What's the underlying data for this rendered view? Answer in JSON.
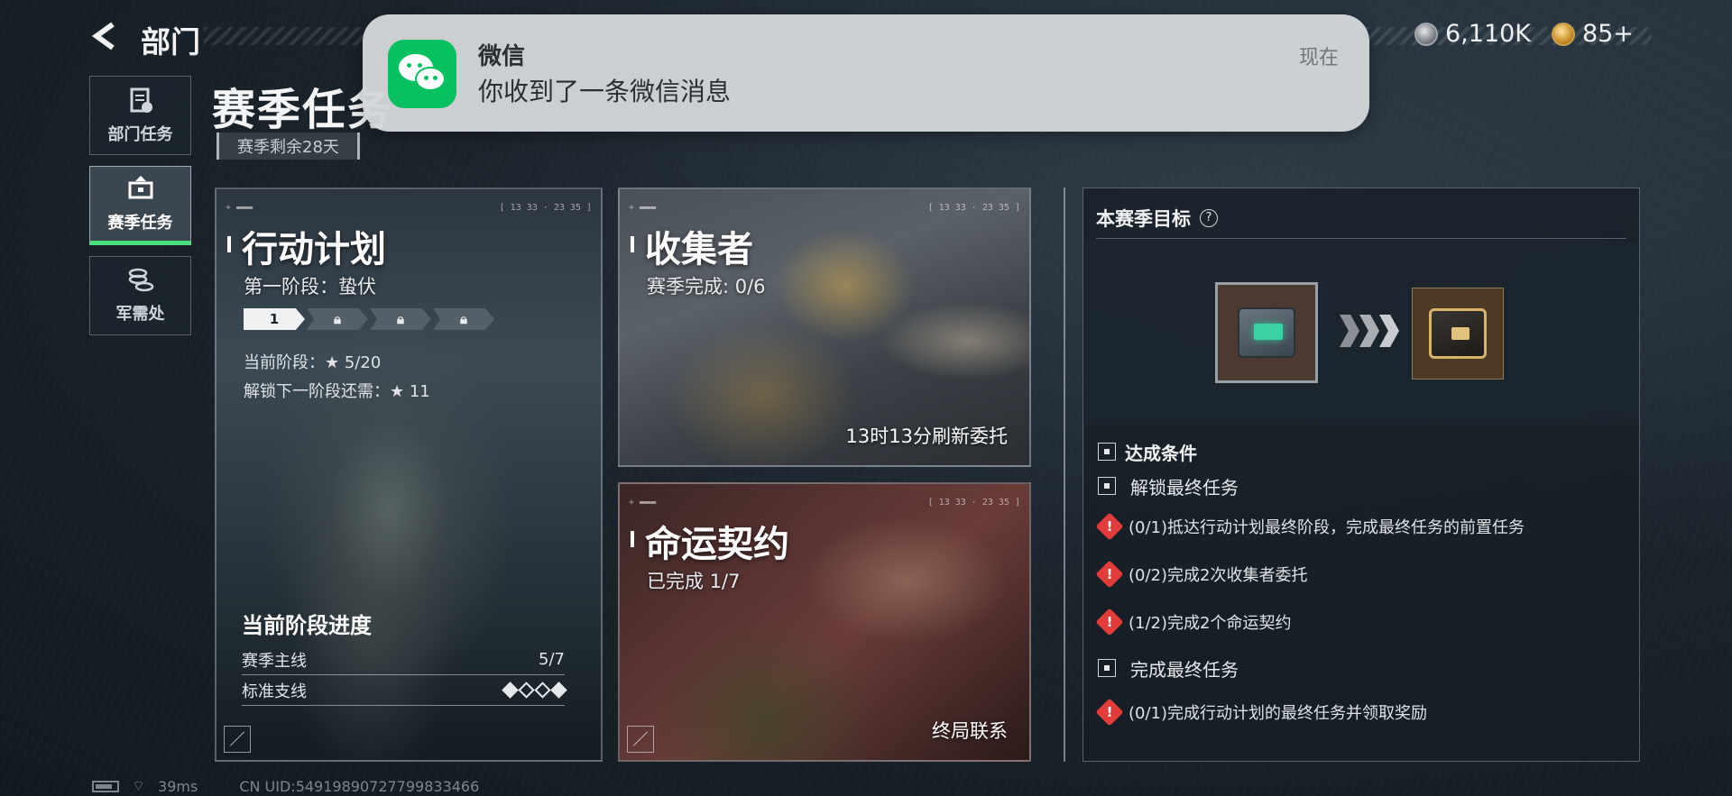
{
  "topbar": {
    "title": "部门",
    "currency_silver": "6,110K",
    "currency_gold": "85+"
  },
  "nav": {
    "items": [
      {
        "label": "部门任务",
        "icon": "clipboard-icon"
      },
      {
        "label": "赛季任务",
        "icon": "briefcase-icon",
        "active": true
      },
      {
        "label": "军需处",
        "icon": "coins-stack-icon"
      }
    ]
  },
  "season": {
    "title": "赛季任务",
    "remaining": "赛季剩余28天"
  },
  "cards": {
    "plan": {
      "title": "行动计划",
      "stage_name": "第一阶段：蛰伏",
      "stage_first": "1",
      "current_stage": "当前阶段：★ 5/20",
      "unlock_next": "解锁下一阶段还需：★ 11",
      "progress_title": "当前阶段进度",
      "row1_label": "赛季主线",
      "row1_value": "5/7",
      "row2_label": "标准支线",
      "diamonds": [
        true,
        false,
        false,
        true
      ],
      "header_time": "[ 13 33 · 23 35 ]"
    },
    "collector": {
      "title": "收集者",
      "status": "赛季完成: 0/6",
      "footer": "13时13分刷新委托",
      "header_time": "[ 13 33 · 23 35 ]"
    },
    "fate": {
      "title": "命运契约",
      "status": "已完成 1/7",
      "footer": "终局联系",
      "header_time": "[ 13 33 · 23 35 ]"
    }
  },
  "goal": {
    "title": "本赛季目标",
    "help": "?",
    "conditions_title": "达成条件",
    "group1": "解锁最终任务",
    "tasks1": [
      "(0/1)抵达行动计划最终阶段，完成最终任务的前置任务",
      "(0/2)完成2次收集者委托",
      "(1/2)完成2个命运契约"
    ],
    "group2": "完成最终任务",
    "tasks2": [
      "(0/1)完成行动计划的最终任务并领取奖励"
    ]
  },
  "status": {
    "ping": "39ms",
    "uid": "CN UID:5491989072779983346​6"
  },
  "notification": {
    "app": "微信",
    "message": "你收到了一条微信消息",
    "time": "现在"
  },
  "colors": {
    "accent_green": "#49e07c",
    "warning_red": "#e23b3b",
    "wechat_green": "#07c160"
  }
}
